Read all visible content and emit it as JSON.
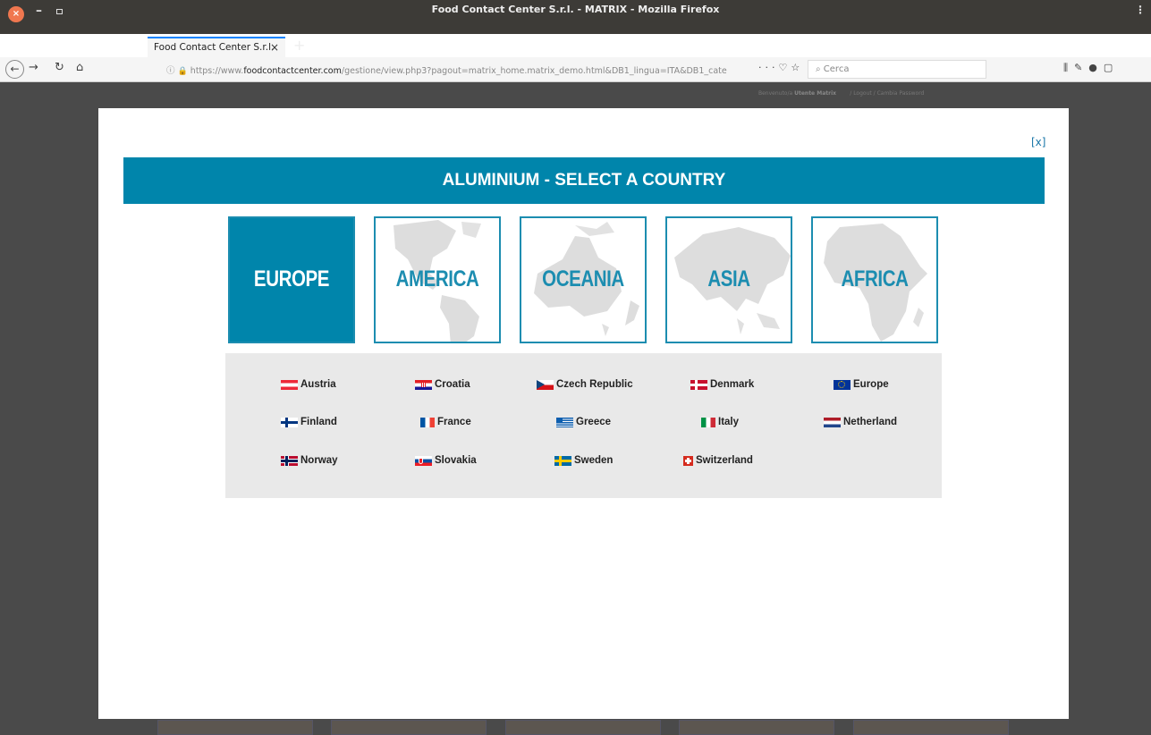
{
  "window": {
    "title": "Food Contact Center S.r.l. - MATRIX - Mozilla Firefox"
  },
  "tab": {
    "label": "Food Contact Center S.r.l.",
    "close": "×",
    "new": "+"
  },
  "nav": {
    "url_prefix": "https://www.",
    "url_host": "foodcontactcenter.com",
    "url_path": "/gestione/view.php3?pagout=matrix_home.matrix_demo.html&DB1_lingua=ITA&DB1_cate",
    "search_placeholder": "Cerca"
  },
  "page": {
    "user_greeting": "Benvenuto/a",
    "user_name": "Utente Matrix",
    "user_links": "/ Logout / Cambia Password"
  },
  "modal": {
    "close_label": "[x]",
    "banner": "ALUMINIUM - SELECT A COUNTRY",
    "regions": [
      {
        "label": "EUROPE",
        "active": true
      },
      {
        "label": "AMERICA",
        "active": false
      },
      {
        "label": "OCEANIA",
        "active": false
      },
      {
        "label": "ASIA",
        "active": false
      },
      {
        "label": "AFRICA",
        "active": false
      }
    ],
    "countries": [
      {
        "name": "Austria",
        "flag": "austria-flag"
      },
      {
        "name": "Croatia",
        "flag": "croatia-flag"
      },
      {
        "name": "Czech Republic",
        "flag": "czech-republic-flag"
      },
      {
        "name": "Denmark",
        "flag": "denmark-flag"
      },
      {
        "name": "Europe",
        "flag": "europe-flag"
      },
      {
        "name": "Finland",
        "flag": "finland-flag"
      },
      {
        "name": "France",
        "flag": "france-flag"
      },
      {
        "name": "Greece",
        "flag": "greece-flag"
      },
      {
        "name": "Italy",
        "flag": "italy-flag"
      },
      {
        "name": "Netherland",
        "flag": "netherland-flag"
      },
      {
        "name": "Norway",
        "flag": "norway-flag"
      },
      {
        "name": "Slovakia",
        "flag": "slovakia-flag"
      },
      {
        "name": "Sweden",
        "flag": "sweden-flag"
      },
      {
        "name": "Switzerland",
        "flag": "switzerland-flag"
      }
    ]
  },
  "colors": {
    "accent": "#0085ab",
    "region_border": "#1c8db0",
    "panel_bg": "#e9e9e9",
    "overlay_bg": "#4a4a4a"
  }
}
